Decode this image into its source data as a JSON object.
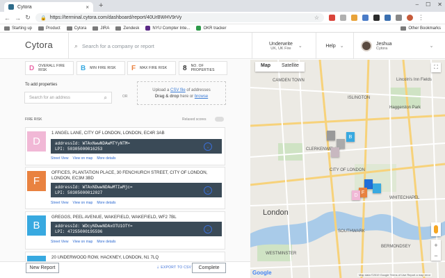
{
  "browser": {
    "tab_title": "Cytora",
    "url": "https://terminal.cytora.com/dashboard/report/40UrBWHV9rVy",
    "bookmarks": [
      "Starting up",
      "Product",
      "Cytora",
      "JIRA",
      "Zendesk",
      "NYU Compter Inte...",
      "OKR tracker"
    ],
    "other_bookmarks": "Other Bookmarks"
  },
  "header": {
    "logo": "Cytora",
    "search_placeholder": "Search for a company or report",
    "underwrite_title": "Underwrite",
    "underwrite_sub": "UK, UK Fire",
    "help": "Help",
    "user_name": "Jeshua",
    "user_org": "Cytora"
  },
  "cards": [
    {
      "letter": "D",
      "label": "OVERALL FIRE RISK",
      "color": "#e96aa8"
    },
    {
      "letter": "B",
      "label": "MIN FIRE RISK",
      "color": "#38a9e0"
    },
    {
      "letter": "F",
      "label": "MAX FIRE RISK",
      "color": "#e98240"
    },
    {
      "letter": "8",
      "label": "NO. OF PROPERTIES",
      "color": "#333333"
    }
  ],
  "add": {
    "label": "To add properties",
    "placeholder": "Search for an address",
    "or": "OR",
    "upload_line1_pre": "Upload a",
    "upload_link1": "CSV file",
    "upload_line1_post": "of addresses",
    "upload_line2_pre": "Drag & drop",
    "upload_line2_mid": "here or",
    "upload_link2": "browse"
  },
  "list": {
    "section_label": "FIRE RISK",
    "relaxed_label": "Relaxed scores"
  },
  "properties": [
    {
      "letter": "D",
      "color": "#f1b8d6",
      "address": "1 ANGEL LANE, CITY OF LONDON, LONDON, EC4R 3AB",
      "address_id": "addressId: WTAxNwwNDAwMTYyNTM=",
      "lpi": "LPI: 50305000016253"
    },
    {
      "letter": "F",
      "color": "#e98240",
      "address": "OFFICES, PLANTATION PLACE, 30 FENCHURCH STREET, CITY OF LONDON, LONDON, EC3M 3BD",
      "address_id": "addressId: WTAxNDwwNDAwMTIwMjc=",
      "lpi": "LPI: 50305000012027"
    },
    {
      "letter": "B",
      "color": "#38a9e0",
      "address": "GREGGS, PEEL AVENUE, WAKEFIELD, WAKEFIELD, WF2 7BL",
      "address_id": "addressId: WDcyNDwwNDAxOTU1OTY=",
      "lpi": "LPI: 47255000195596"
    },
    {
      "letter": "",
      "color": "#38a9e0",
      "address": "20 UNDERWOOD ROW, HACKNEY, LONDON, N1 7LQ",
      "address_id": "",
      "lpi": ""
    }
  ],
  "property_links": {
    "street": "Street View",
    "map": "View on map",
    "details": "More details"
  },
  "footer": {
    "new_report": "New Report",
    "export": "EXPORT TO CSV",
    "complete": "Complete"
  },
  "map": {
    "tabs": [
      "Map",
      "Satellite"
    ],
    "labels": [
      "ISLINGTON",
      "London",
      "CLERKENWELL",
      "CITY OF LONDON",
      "SOUTHWARK",
      "BERMONDSEY",
      "CAMDEN TOWN",
      "WHITECHAPEL",
      "WESTMINSTER",
      "Lincoln's Inn Fields",
      "Haggerston Park"
    ],
    "attribution": "Map data ©2019 Google   Terms of Use   Report a map error",
    "google": "Google"
  }
}
